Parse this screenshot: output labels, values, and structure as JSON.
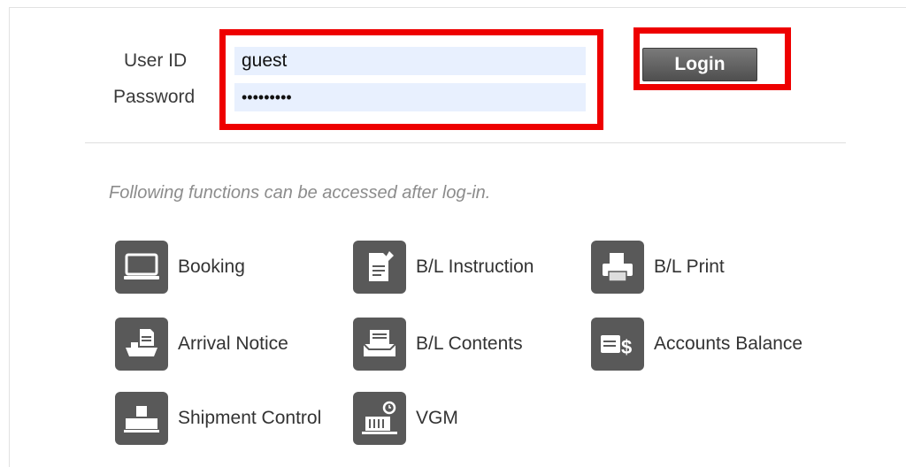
{
  "login": {
    "user_id_label": "User ID",
    "password_label": "Password",
    "user_id_value": "guest",
    "password_value": "guest1234",
    "login_button": "Login"
  },
  "notice": "Following functions can be accessed after log-in.",
  "functions": [
    {
      "label": "Booking",
      "icon": "monitor-icon"
    },
    {
      "label": "B/L Instruction",
      "icon": "document-edit-icon"
    },
    {
      "label": "B/L Print",
      "icon": "printer-icon"
    },
    {
      "label": "Arrival Notice",
      "icon": "ship-document-icon"
    },
    {
      "label": "B/L Contents",
      "icon": "document-tray-icon"
    },
    {
      "label": "Accounts Balance",
      "icon": "money-icon"
    },
    {
      "label": "Shipment Control",
      "icon": "containers-icon"
    },
    {
      "label": "VGM",
      "icon": "scale-icon"
    }
  ],
  "colors": {
    "highlight": "#ee0000",
    "field_bg": "#e8f0fe",
    "icon_bg": "#595959",
    "notice_text": "#8c8c8c"
  }
}
